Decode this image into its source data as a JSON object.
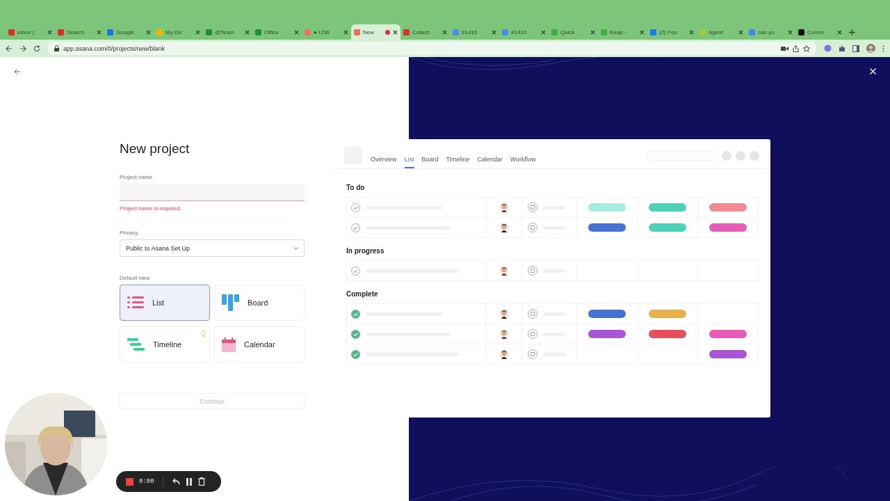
{
  "browser": {
    "tabs": [
      {
        "title": "Inbox (",
        "selected": false,
        "color": "#d93025"
      },
      {
        "title": "Search",
        "selected": false,
        "color": "#d93025"
      },
      {
        "title": "Google",
        "selected": false,
        "color": "#1a73e8"
      },
      {
        "title": "My Dri",
        "selected": false,
        "color": "#f4b400"
      },
      {
        "title": "@Team",
        "selected": false,
        "color": "#1e8e3e"
      },
      {
        "title": "Office",
        "selected": false,
        "color": "#1e8e3e"
      },
      {
        "title": "● LDB",
        "selected": false,
        "color": "#e8735a"
      },
      {
        "title": "New",
        "selected": true,
        "color": "#e8735a",
        "recording": true
      },
      {
        "title": "Collect",
        "selected": false,
        "color": "#d93025"
      },
      {
        "title": "#1410",
        "selected": false,
        "color": "#4a90e2"
      },
      {
        "title": "#1410",
        "selected": false,
        "color": "#4a90e2"
      },
      {
        "title": "Quick",
        "selected": false,
        "color": "#3cb043"
      },
      {
        "title": "Keap -",
        "selected": false,
        "color": "#3cb043"
      },
      {
        "title": "(2) Foo",
        "selected": false,
        "color": "#1877f2"
      },
      {
        "title": "Agent",
        "selected": false,
        "color": "#a4c639"
      },
      {
        "title": "can yo",
        "selected": false,
        "color": "#4285f4"
      },
      {
        "title": "Comm",
        "selected": false,
        "color": "#111111"
      }
    ],
    "url": "app.asana.com/0/projects/new/blank"
  },
  "form": {
    "title": "New project",
    "project_name": {
      "label": "Project name",
      "error": "Project name is required."
    },
    "privacy": {
      "label": "Privacy",
      "value": "Public to Asana Set Up"
    },
    "default_view": {
      "label": "Default view",
      "options": [
        {
          "label": "List",
          "kind": "list",
          "selected": true
        },
        {
          "label": "Board",
          "kind": "board",
          "selected": false
        },
        {
          "label": "Timeline",
          "kind": "timeline",
          "selected": false
        },
        {
          "label": "Calendar",
          "kind": "calendar",
          "selected": false
        }
      ]
    },
    "continue_button": {
      "label": "Continue",
      "disabled": true
    }
  },
  "preview": {
    "tabs": [
      {
        "label": "Overview",
        "selected": false
      },
      {
        "label": "List",
        "selected": true
      },
      {
        "label": "Board",
        "selected": false
      },
      {
        "label": "Timeline",
        "selected": false
      },
      {
        "label": "Calendar",
        "selected": false
      },
      {
        "label": "Workflow",
        "selected": false
      }
    ],
    "sections": [
      {
        "title": "To do",
        "rows": [
          {
            "done": false,
            "cells": [
              {
                "color": "#a8ebe0"
              },
              {
                "color": "#4fd1b9"
              },
              {
                "color": "#f08a94"
              }
            ]
          },
          {
            "done": false,
            "cells": [
              {
                "color": "#4573d2"
              },
              {
                "color": "#4fd1b9"
              },
              {
                "color": "#e85cb9"
              }
            ]
          }
        ]
      },
      {
        "title": "In progress",
        "rows": [
          {
            "done": false,
            "cells": [
              null,
              null,
              null
            ]
          }
        ]
      },
      {
        "title": "Complete",
        "rows": [
          {
            "done": true,
            "cells": [
              {
                "color": "#4573d2"
              },
              {
                "color": "#e8b04a"
              },
              null
            ]
          },
          {
            "done": true,
            "cells": [
              {
                "color": "#a855d6"
              },
              {
                "color": "#e5505e"
              },
              {
                "color": "#e85cb9"
              }
            ]
          },
          {
            "done": true,
            "cells": [
              null,
              null,
              {
                "color": "#a855d6"
              }
            ]
          }
        ]
      }
    ]
  },
  "recorder": {
    "time": "0:00"
  }
}
